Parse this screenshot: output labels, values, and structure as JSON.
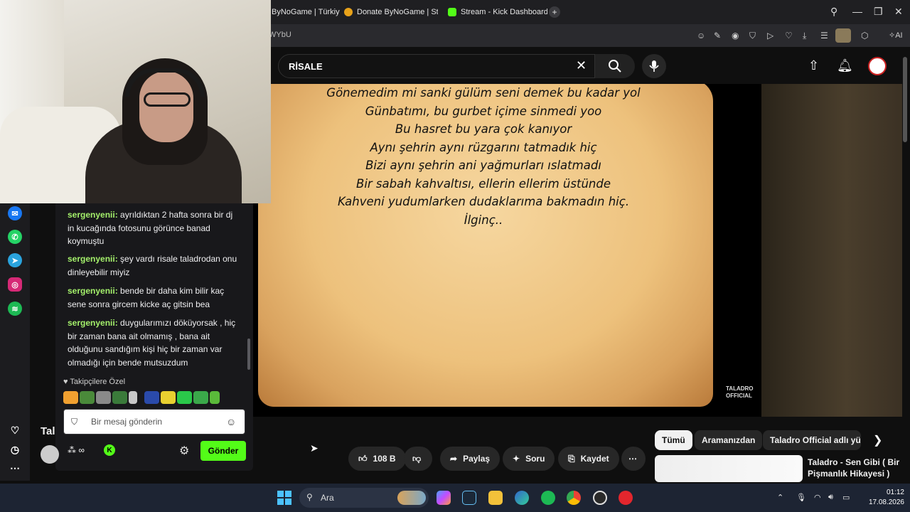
{
  "browser": {
    "tabs": [
      {
        "label": "ByNoGame | Türkiye'nin E",
        "icon": "bynogame-icon"
      },
      {
        "label": "Donate ByNoGame | Strea",
        "icon": "bynogame-icon"
      },
      {
        "label": "Stream - Kick Dashboard",
        "icon": "kick-icon"
      }
    ],
    "new_tab": "+",
    "url_fragment": "WYbU",
    "ai_label": "AI"
  },
  "youtube": {
    "search_value": "RİSALE",
    "video": {
      "lyrics": [
        "Gönemedim mi sanki gülüm seni demek bu kadar yol",
        "Günbatımı, bu gurbet içime sinmedi yoo",
        "Bu hasret bu yara çok kanıyor",
        "Aynı şehrin aynı rüzgarını tatmadık hiç",
        "Bizi aynı şehrin ani yağmurları ıslatmadı",
        "Bir sabah kahvaltısı, ellerin ellerim üstünde",
        "Kahveni yudumlarken dudaklarıma bakmadın hiç.",
        "İlginç.."
      ],
      "watermark": "TALADRO OFFICIAL"
    },
    "title_stub": "Tal",
    "actions": {
      "likes": "108 B",
      "share": "Paylaş",
      "ask": "Soru",
      "save": "Kaydet"
    },
    "chips": [
      "Tümü",
      "Aramanızdan",
      "Taladro Official adlı yük"
    ],
    "recommendation": {
      "title": "Taladro - Sen Gibi ( Bir Pişmanlık Hikayesi )"
    }
  },
  "chat": {
    "messages": [
      {
        "user": "sergenyenii:",
        "text": "ayrıldıktan 2 hafta sonra bir dj in kucağında fotosunu görünce banad koymuştu"
      },
      {
        "user": "sergenyenii:",
        "text": "şey vardı risale taladrodan onu dinleyebilir miyiz"
      },
      {
        "user": "sergenyenii:",
        "text": "bende bir daha kim bilir kaç sene sonra gircem kicke aç gitsin bea"
      },
      {
        "user": "sergenyenii:",
        "text": "duygularımızı döküyorsak , hiç bir zaman bana ait olmamış , bana ait olduğunu sandığım kişi hiç bir zaman var olmadığı için bende mutsuzdum"
      }
    ],
    "followers_label": "Takipçilere Özel",
    "input_placeholder": "Bir mesaj gönderin",
    "footer_infinity": "∞",
    "send_label": "Gönder"
  },
  "taskbar": {
    "search_label": "Ara",
    "time": "01:12",
    "date": "17.08.2026"
  },
  "colors": {
    "kick_green": "#53fc18",
    "chat_username": "#a4f06b",
    "youtube_bg": "#0f0f0f"
  }
}
